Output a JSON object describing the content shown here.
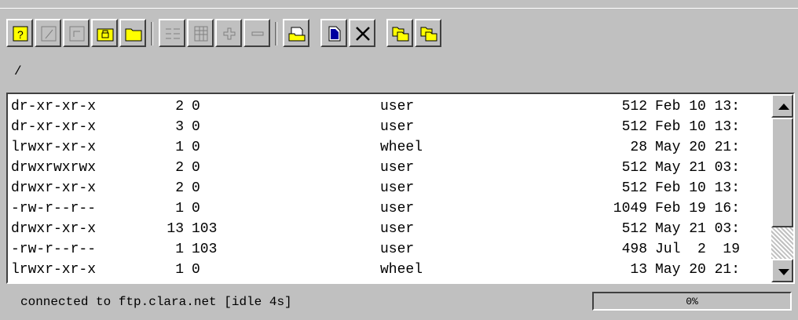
{
  "toolbar": {
    "buttons": [
      {
        "name": "help-icon"
      },
      {
        "name": "edit-icon"
      },
      {
        "name": "up-folder-icon"
      },
      {
        "name": "lock-folder-icon"
      },
      {
        "name": "folder-icon"
      },
      {
        "name": "list-view-icon"
      },
      {
        "name": "detail-view-icon"
      },
      {
        "name": "add-icon"
      },
      {
        "name": "remove-icon"
      },
      {
        "name": "open-file-icon"
      },
      {
        "name": "new-file-icon"
      },
      {
        "name": "delete-icon"
      },
      {
        "name": "copy-icon"
      },
      {
        "name": "paste-icon"
      }
    ]
  },
  "path": "/",
  "files": [
    {
      "perm": "dr-xr-xr-x",
      "links": "2",
      "owner": "0",
      "group": "user",
      "size": "512",
      "date": "Feb 10 13:"
    },
    {
      "perm": "dr-xr-xr-x",
      "links": "3",
      "owner": "0",
      "group": "user",
      "size": "512",
      "date": "Feb 10 13:"
    },
    {
      "perm": "lrwxr-xr-x",
      "links": "1",
      "owner": "0",
      "group": "wheel",
      "size": "28",
      "date": "May 20 21:"
    },
    {
      "perm": "drwxrwxrwx",
      "links": "2",
      "owner": "0",
      "group": "user",
      "size": "512",
      "date": "May 21 03:"
    },
    {
      "perm": "drwxr-xr-x",
      "links": "2",
      "owner": "0",
      "group": "user",
      "size": "512",
      "date": "Feb 10 13:"
    },
    {
      "perm": "-rw-r--r--",
      "links": "1",
      "owner": "0",
      "group": "user",
      "size": "1049",
      "date": "Feb 19 16:"
    },
    {
      "perm": "drwxr-xr-x",
      "links": "13",
      "owner": "103",
      "group": "user",
      "size": "512",
      "date": "May 21 03:"
    },
    {
      "perm": "-rw-r--r--",
      "links": "1",
      "owner": "103",
      "group": "user",
      "size": "498",
      "date": "Jul  2  19"
    },
    {
      "perm": "lrwxr-xr-x",
      "links": "1",
      "owner": "0",
      "group": "wheel",
      "size": "13",
      "date": "May 20 21:"
    }
  ],
  "status": {
    "text": "connected to ftp.clara.net [idle 4s]",
    "progress_label": "0%",
    "progress": 0
  }
}
